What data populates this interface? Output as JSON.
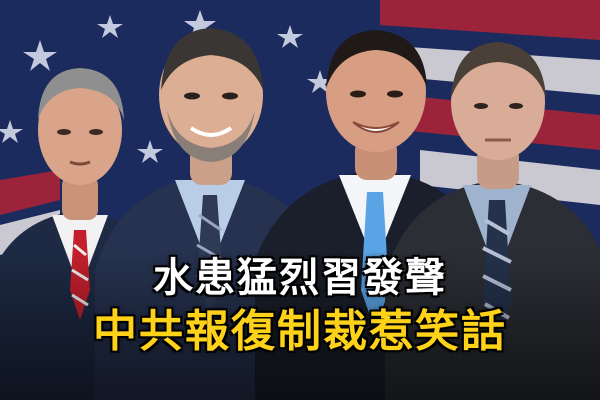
{
  "image": {
    "headline_line1": "水患猛烈習發聲",
    "headline_line2": "中共報復制裁惹笑話",
    "colors": {
      "headline_line1": "#ffffff",
      "headline_line2": "#ffd21a",
      "flag_red": "#b22234",
      "flag_blue": "#1c2b5e"
    }
  }
}
